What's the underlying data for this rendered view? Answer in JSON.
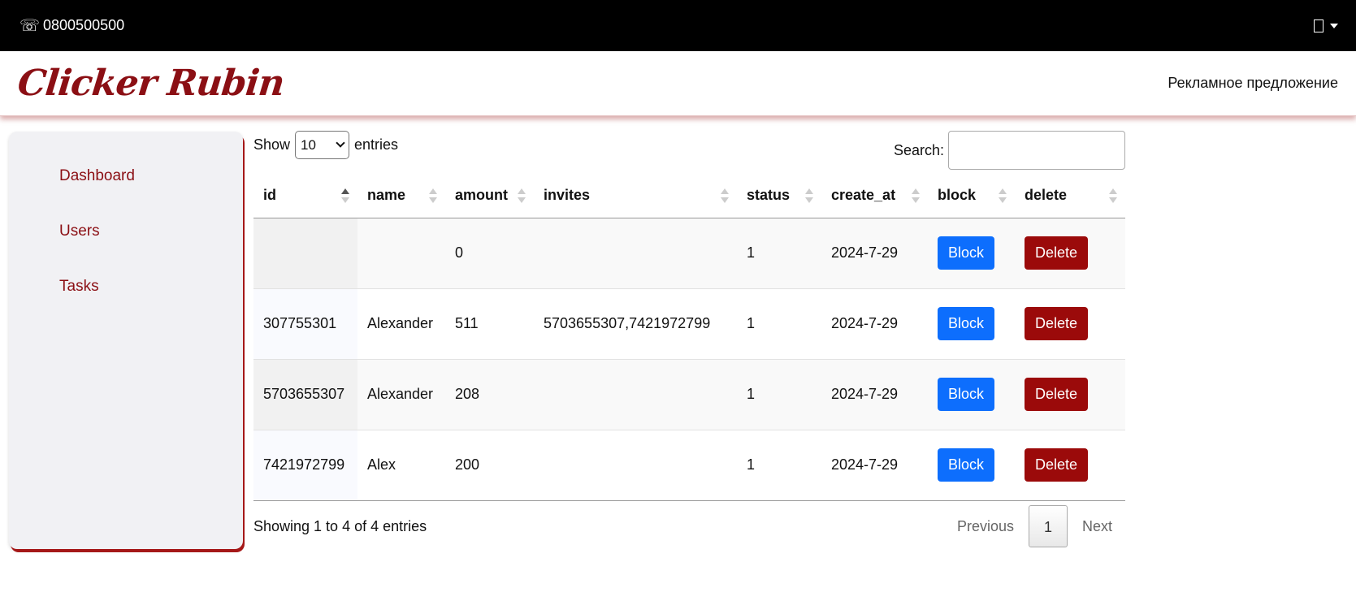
{
  "topbar": {
    "phone_icon": "☏",
    "phone": "0800500500",
    "user_icon": "user-icon"
  },
  "header": {
    "logo": "Clicker Rubin",
    "promo_link": "Рекламное предложение"
  },
  "sidebar": {
    "items": [
      {
        "label": "Dashboard"
      },
      {
        "label": "Users"
      },
      {
        "label": "Tasks"
      }
    ]
  },
  "table_controls": {
    "show_label": "Show",
    "entries_label": "entries",
    "page_length": "10",
    "search_label": "Search:",
    "search_value": ""
  },
  "table": {
    "columns": [
      "id",
      "name",
      "amount",
      "invites",
      "status",
      "create_at",
      "block",
      "delete"
    ],
    "sorted_column": "id",
    "sort_direction": "asc",
    "rows": [
      {
        "id": "",
        "name": "",
        "amount": "0",
        "invites": "",
        "status": "1",
        "create_at": "2024-7-29",
        "block": "Block",
        "delete": "Delete"
      },
      {
        "id": "307755301",
        "name": "Alexander",
        "amount": "511",
        "invites": "5703655307,7421972799",
        "status": "1",
        "create_at": "2024-7-29",
        "block": "Block",
        "delete": "Delete"
      },
      {
        "id": "5703655307",
        "name": "Alexander",
        "amount": "208",
        "invites": "",
        "status": "1",
        "create_at": "2024-7-29",
        "block": "Block",
        "delete": "Delete"
      },
      {
        "id": "7421972799",
        "name": "Alex",
        "amount": "200",
        "invites": "",
        "status": "1",
        "create_at": "2024-7-29",
        "block": "Block",
        "delete": "Delete"
      }
    ]
  },
  "footer": {
    "info": "Showing 1 to 4 of 4 entries",
    "previous": "Previous",
    "current_page": "1",
    "next": "Next"
  },
  "colors": {
    "topbar": "#000000",
    "brand": "#8b0f14",
    "block_button": "#0d6efd",
    "delete_button": "#9b0a0a",
    "sidebar_bg": "#f1f1f4"
  }
}
